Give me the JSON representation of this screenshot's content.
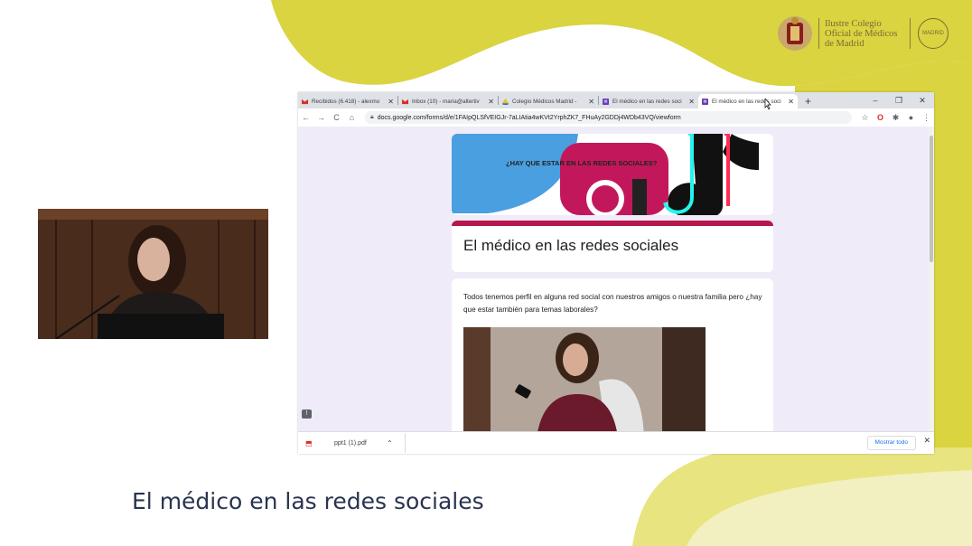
{
  "org": {
    "name_line1": "Ilustre Colegio",
    "name_line2": "Oficial de Médicos",
    "name_line3": "de Madrid",
    "seal_text": "MADRID"
  },
  "colors": {
    "accent_yellow": "#d9d440",
    "form_accent": "#b5164b",
    "form_bg": "#f0ebf8",
    "subtitle": "#2a3350"
  },
  "browser": {
    "tabs": [
      {
        "label": "Recibidos (6.418) - alexmo",
        "icon": "gmail-icon"
      },
      {
        "label": "Inbox (10) - maria@altertiv",
        "icon": "gmail-icon"
      },
      {
        "label": "Colegio Médicos Madrid -",
        "icon": "drive-icon"
      },
      {
        "label": "El médico en las redes soci",
        "icon": "forms-icon"
      },
      {
        "label": "El médico en las redes soci",
        "icon": "forms-icon"
      }
    ],
    "url": "docs.google.com/forms/d/e/1FAIpQLSfVEIGJr-7aLIAtia4wKVt2YrphZK7_FHuAy2GDDj4WDb43VQ/viewform"
  },
  "form": {
    "banner_text": "¿HAY QUE ESTAR EN LAS REDES SOCIALES?",
    "title": "El médico en las redes sociales",
    "description": "Todos tenemos perfil en alguna red social con nuestros amigos o nuestra familia pero ¿hay que estar también para temas laborales?"
  },
  "downloads": {
    "file": "ppt1 (1).pdf",
    "show_all": "Mostrar todo"
  },
  "slide": {
    "subtitle": "El médico en las redes sociales"
  }
}
